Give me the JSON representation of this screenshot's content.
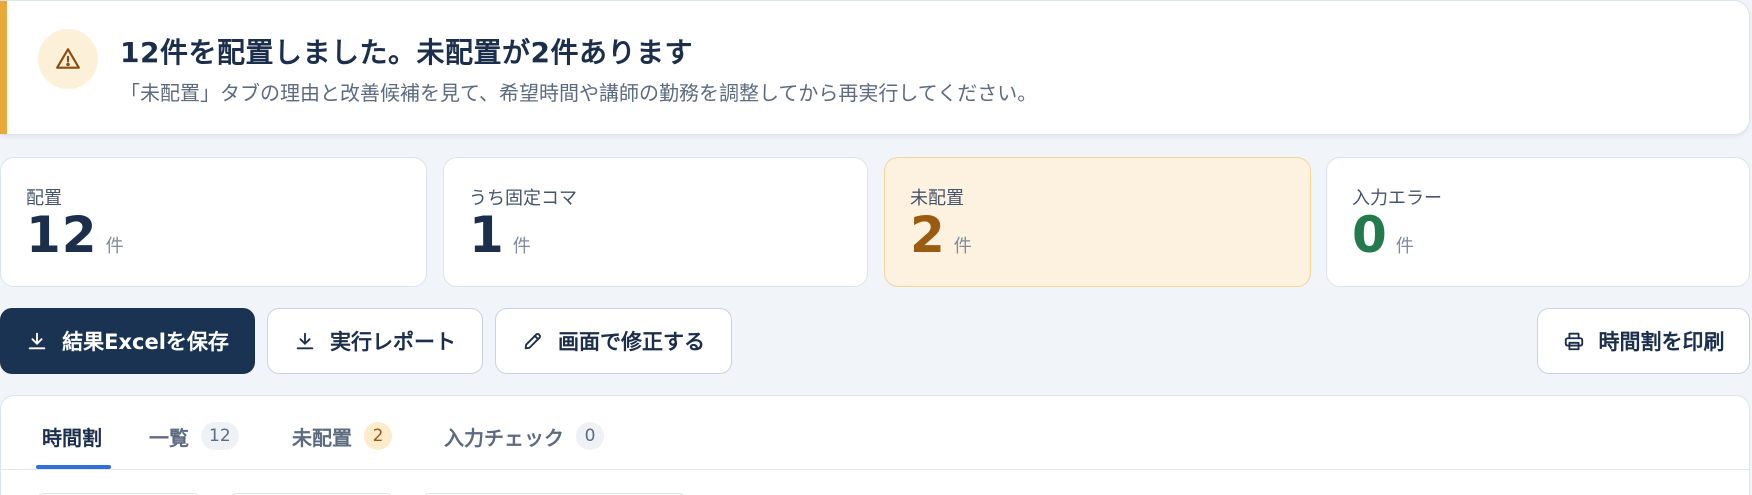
{
  "alert": {
    "title": "12件を配置しました。未配置が2件あります",
    "description": "「未配置」タブの理由と改善候補を見て、希望時間や講師の勤務を調整してから再実行してください。",
    "icon": "warning-triangle-icon",
    "accent_color": "#e9a93a"
  },
  "stats": [
    {
      "label": "配置",
      "value": "12",
      "unit": "件"
    },
    {
      "label": "うち固定コマ",
      "value": "1",
      "unit": "件"
    },
    {
      "label": "未配置",
      "value": "2",
      "unit": "件"
    },
    {
      "label": "入力エラー",
      "value": "0",
      "unit": "件"
    }
  ],
  "actions": {
    "save_excel": "結果Excelを保存",
    "report": "実行レポート",
    "edit_on_screen": "画面で修正する",
    "print": "時間割を印刷"
  },
  "tabs": [
    {
      "label": "時間割",
      "count": null,
      "active": true
    },
    {
      "label": "一覧",
      "count": "12"
    },
    {
      "label": "未配置",
      "count": "2"
    },
    {
      "label": "入力チェック",
      "count": "0"
    }
  ],
  "colors": {
    "primary": "#1a3352",
    "warning": "#9a5a0f",
    "success": "#237a4c",
    "tab_active": "#2f6fd6"
  }
}
